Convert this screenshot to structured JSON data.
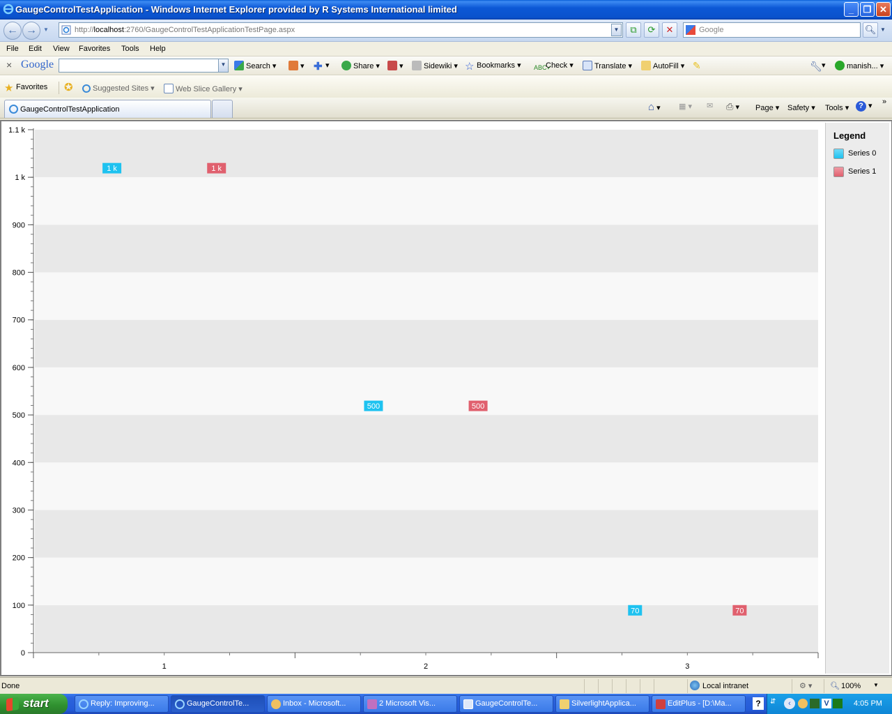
{
  "window": {
    "title": "GaugeControlTestApplication - Windows Internet Explorer provided by R Systems International limited"
  },
  "address": {
    "url_prefix": "http://",
    "url_host": "localhost",
    "url_rest": ":2760/GaugeControlTestApplicationTestPage.aspx"
  },
  "search": {
    "placeholder": "Google"
  },
  "menu": [
    "File",
    "Edit",
    "View",
    "Favorites",
    "Tools",
    "Help"
  ],
  "google_toolbar": {
    "logo": "Google",
    "search_label": "Search",
    "share_label": "Share",
    "sidewiki_label": "Sidewiki",
    "bookmarks_label": "Bookmarks",
    "check_label": "Check",
    "translate_label": "Translate",
    "autofill_label": "AutoFill",
    "user_label": "manish..."
  },
  "favorites_bar": {
    "favorites_label": "Favorites",
    "suggested_sites": "Suggested Sites",
    "web_slice_gallery": "Web Slice Gallery"
  },
  "tab": {
    "label": "GaugeControlTestApplication"
  },
  "command_bar": {
    "page": "Page",
    "safety": "Safety",
    "tools": "Tools"
  },
  "status": {
    "left": "Done",
    "zone": "Local intranet",
    "zoom": "100%"
  },
  "taskbar": {
    "start": "start",
    "items": [
      "Reply: Improving...",
      "GaugeControlTe...",
      "Inbox - Microsoft...",
      "2 Microsoft Vis...",
      "GaugeControlTe...",
      "SilverlightApplica...",
      "EditPlus - [D:\\Ma..."
    ],
    "clock": "4:05 PM"
  },
  "legend": {
    "title": "Legend",
    "items": [
      {
        "label": "Series 0",
        "color": "#1ec2f0"
      },
      {
        "label": "Series 1",
        "color": "#e0606e"
      }
    ]
  },
  "chart_data": {
    "type": "scatter",
    "categories": [
      "1",
      "2",
      "3"
    ],
    "y_tick_labels": [
      "0",
      "100",
      "200",
      "300",
      "400",
      "500",
      "600",
      "700",
      "800",
      "900",
      "1 k",
      "1.1 k"
    ],
    "ylim": [
      0,
      1100
    ],
    "series": [
      {
        "name": "Series 0",
        "color": "#1ec2f0",
        "values": [
          1000,
          500,
          70
        ],
        "labels": [
          "1 k",
          "500",
          "70"
        ]
      },
      {
        "name": "Series 1",
        "color": "#e0606e",
        "values": [
          1000,
          500,
          70
        ],
        "labels": [
          "1 k",
          "500",
          "70"
        ]
      }
    ],
    "band_colors": [
      "#e8e8e8",
      "#f8f8f8"
    ],
    "grid": true,
    "legend_position": "right"
  }
}
